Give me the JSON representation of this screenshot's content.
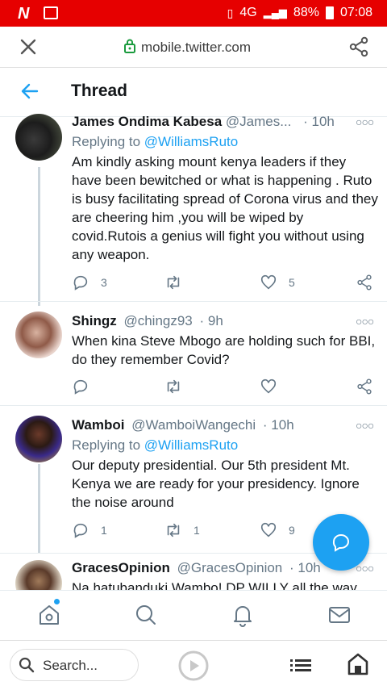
{
  "status_bar": {
    "network": "4G",
    "battery": "88%",
    "time": "07:08"
  },
  "url_bar": {
    "url": "mobile.twitter.com"
  },
  "header": {
    "title": "Thread"
  },
  "tweets": [
    {
      "name": "James Ondima Kabesa",
      "handle": "@James...",
      "time": "· 10h",
      "replying_prefix": "Replying to ",
      "replying_to": "@WilliamsRuto",
      "text": "Am kindly asking mount kenya leaders if they have been bewitched or what is happening . Ruto is busy facilitating spread of Corona virus and they are cheering him ,you will be wiped by covid.Rutois a genius will fight you without using any weapon.",
      "replies": "3",
      "retweets": "",
      "likes": "5"
    },
    {
      "name": "Shingz",
      "handle": "@chingz93",
      "time": "· 9h",
      "text": "When kina Steve Mbogo are holding such for BBI, do they remember Covid?",
      "replies": "",
      "retweets": "",
      "likes": ""
    },
    {
      "name": "Wamboi",
      "handle": "@WamboiWangechi",
      "time": "· 10h",
      "replying_prefix": "Replying to ",
      "replying_to": "@WilliamsRuto",
      "text": "Our deputy presidential. Our 5th president Mt. Kenya we are ready for your presidency. Ignore the noise around",
      "replies": "1",
      "retweets": "1",
      "likes": "9"
    },
    {
      "name": "GracesOpinion",
      "handle": "@GracesOpinion",
      "time": "· 10h",
      "text": "Na hatubanduki Wambo! DP WILLY all the way"
    }
  ],
  "browser_bar": {
    "search_placeholder": "Search..."
  },
  "colors": {
    "accent": "#1da1f2",
    "status_bar": "#e60000",
    "muted": "#657786"
  }
}
